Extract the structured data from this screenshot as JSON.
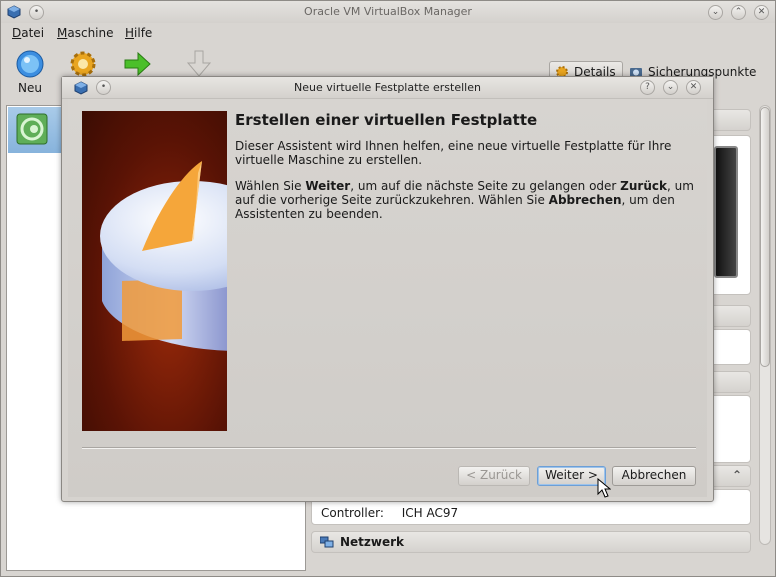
{
  "main_window": {
    "title": "Oracle VM VirtualBox Manager",
    "menu": [
      {
        "label": "Datei",
        "accel": "D",
        "rest": "atei"
      },
      {
        "label": "Maschine",
        "accel": "M",
        "rest": "aschine"
      },
      {
        "label": "Hilfe",
        "accel": "H",
        "rest": "ilfe"
      }
    ],
    "toolbar": {
      "new_label": "Neu"
    },
    "tabs": {
      "details": "Details",
      "snapshots": "Sicherungspunkte"
    },
    "audio": {
      "controller_label": "Controller:",
      "controller_value": "ICH AC97"
    },
    "network_header": "Netzwerk"
  },
  "dialog": {
    "title": "Neue virtuelle Festplatte erstellen",
    "heading": "Erstellen einer virtuellen Festplatte",
    "paragraph1": "Dieser Assistent wird Ihnen helfen, eine neue virtuelle Festplatte für Ihre virtuelle Maschine zu erstellen.",
    "paragraph2": {
      "p1": "Wählen Sie ",
      "b1": "Weiter",
      "p2": ", um auf die nächste Seite zu gelangen oder ",
      "b2": "Zurück",
      "p3": ", um auf die vorherige Seite zurückzukehren. Wählen Sie ",
      "b3": "Abbrechen",
      "p4": ", um den Assistenten zu beenden."
    },
    "buttons": {
      "back": "< Zurück",
      "next": "Weiter >",
      "cancel": "Abbrechen"
    }
  },
  "colors": {
    "selection": "#87b3dc",
    "wizard_bg": "#5a1305",
    "pie_slice": "#f5a63a"
  }
}
